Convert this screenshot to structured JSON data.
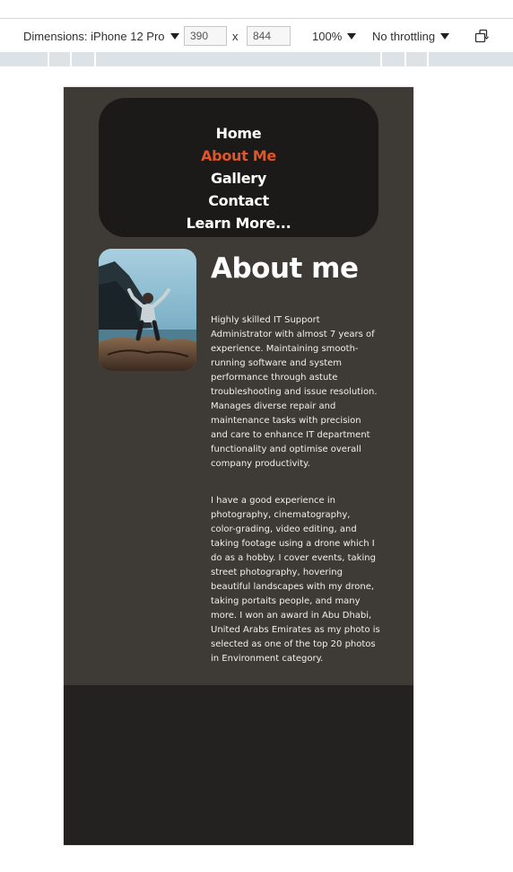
{
  "devtools": {
    "dimensions_label": "Dimensions: iPhone 12 Pro",
    "width_value": "390",
    "times_sign": "x",
    "height_value": "844",
    "zoom": "100%",
    "throttling": "No throttling"
  },
  "nav": {
    "items": [
      {
        "label": "Home"
      },
      {
        "label": "About Me"
      },
      {
        "label": "Gallery"
      },
      {
        "label": "Contact"
      },
      {
        "label": "Learn More..."
      }
    ],
    "active_color": "#e0552a"
  },
  "about": {
    "title": "About me",
    "paragraph1_lines": [
      "Highly skilled IT Support",
      "Administrator with almost 7 years of",
      "experience. Maintaining smooth-",
      "running software and system",
      "performance through astute",
      "troubleshooting and issue resolution.",
      "Manages diverse repair and",
      "maintenance tasks with precision",
      "and care to enhance IT department",
      "functionality and optimise overall",
      "company productivity."
    ],
    "paragraph2_lines": [
      "I have a good experience in",
      "photography, cinematography,",
      "color-grading, video editing, and",
      "taking footage using a drone which I",
      "do as a hobby. I cover events, taking",
      "street photography, hovering",
      "beautiful landscapes with my drone,",
      "taking portaits people, and many",
      "more. I won an award in Abu Dhabi,",
      "United Arabs Emirates as my photo is",
      "selected as one of the top 20 photos",
      "in Environment category."
    ]
  },
  "colors": {
    "page_bg": "#3e3a35",
    "footer_bg": "#232220",
    "nav_bg": "#1b1a18"
  }
}
